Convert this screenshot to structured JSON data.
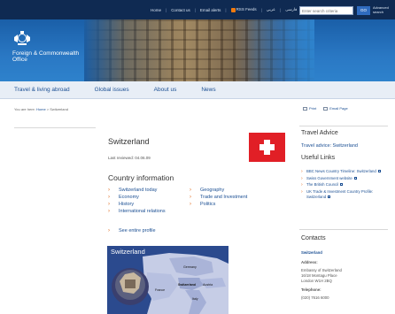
{
  "topnav": {
    "links": [
      "Home",
      "Contact us",
      "Email alerts",
      "RSS Feeds",
      "عربي",
      "فارسی"
    ],
    "search_placeholder": "Enter search criteria",
    "go_label": "GO",
    "advanced_label": "Advanced search"
  },
  "banner": {
    "org_name": "Foreign & Commonwealth Office"
  },
  "mainnav": {
    "items": [
      "Travel & living abroad",
      "Global issues",
      "About us",
      "News"
    ]
  },
  "breadcrumb": {
    "prefix": "You are here:",
    "home": "Home",
    "separator": ">",
    "current": "Switzerland"
  },
  "tools": {
    "print": "Print",
    "email": "Email Page"
  },
  "country": {
    "title": "Switzerland",
    "reviewed": "Last reviewed: 04.06.09",
    "flag_colors": {
      "field": "#e11f26",
      "cross": "#ffffff"
    }
  },
  "country_information": {
    "heading": "Country information",
    "col1": [
      "Switzerland today",
      "Economy",
      "History",
      "International relations"
    ],
    "col2": [
      "Geography",
      "Trade and Investment",
      "Politics"
    ],
    "see_profile": "See entire profile"
  },
  "map": {
    "title": "Switzerland",
    "labels": [
      "Germany",
      "France",
      "Switzerland",
      "Austria",
      "Italy"
    ]
  },
  "sidebar": {
    "travel_heading": "Travel Advice",
    "travel_link": "Travel advice: Switzerland",
    "useful_heading": "Useful Links",
    "useful_links": [
      "BBC News Country Timeline: Switzerland",
      "Swiss Government website",
      "The British Council",
      "UK Trade & Investment Country Profile: Switzerland"
    ],
    "contacts_heading": "Contacts",
    "contact_name": "Switzerland",
    "address_label": "Address:",
    "address_lines": [
      "Embassy of Switzerland",
      "16/18 Montagu Place",
      "London W1H 2BQ"
    ],
    "telephone_label": "Telephone:",
    "telephone": "(020) 7616 6000"
  },
  "colors": {
    "topbar": "#0f2a52",
    "banner": "#2a78c4",
    "link": "#1b4f93",
    "bullet": "#e0691b",
    "nav_bg": "#e8eef6",
    "map_bg": "#2b4a8e"
  }
}
